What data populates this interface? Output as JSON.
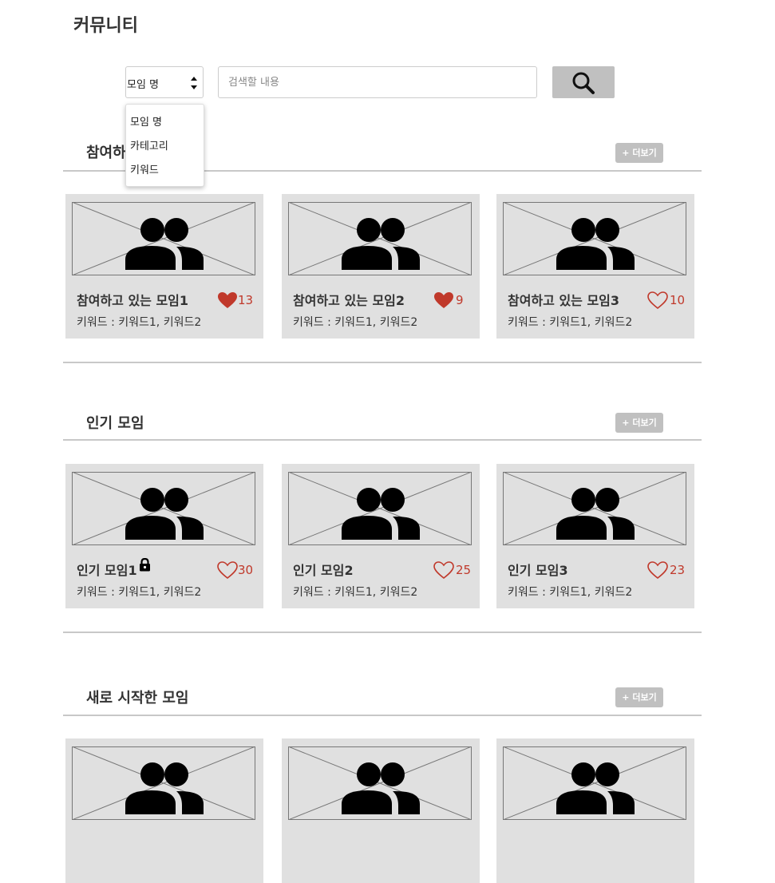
{
  "page_title": "커뮤니티",
  "search": {
    "select_value": "모임 명",
    "placeholder": "검색할 내용",
    "options": [
      "모임 명",
      "카테고리",
      "키워드"
    ]
  },
  "sections": [
    {
      "title": "참여하고 있는 모임",
      "more_label": "+ 더보기",
      "cards": [
        {
          "title": "참여하고 있는 모임1",
          "keywords": "키워드 : 키워드1, 키워드2",
          "likes": "13",
          "liked": true,
          "locked": false
        },
        {
          "title": "참여하고 있는 모임2",
          "keywords": "키워드 : 키워드1, 키워드2",
          "likes": "9",
          "liked": true,
          "locked": false
        },
        {
          "title": "참여하고 있는 모임3",
          "keywords": "키워드 : 키워드1, 키워드2",
          "likes": "10",
          "liked": false,
          "locked": false
        }
      ]
    },
    {
      "title": "인기 모임",
      "more_label": "+ 더보기",
      "cards": [
        {
          "title": "인기 모임1",
          "keywords": "키워드 : 키워드1, 키워드2",
          "likes": "30",
          "liked": false,
          "locked": true
        },
        {
          "title": "인기 모임2",
          "keywords": "키워드 : 키워드1, 키워드2",
          "likes": "25",
          "liked": false,
          "locked": false
        },
        {
          "title": "인기 모임3",
          "keywords": "키워드 : 키워드1, 키워드2",
          "likes": "23",
          "liked": false,
          "locked": false
        }
      ]
    },
    {
      "title": "새로 시작한 모임",
      "more_label": "+ 더보기",
      "cards": [
        {},
        {},
        {}
      ]
    }
  ],
  "colors": {
    "heart": "#c0392b",
    "card_bg": "#e0e0e0",
    "button_bg": "#c0c0c0"
  },
  "icons": {
    "search": "magnifier-icon",
    "group": "group-people-icon",
    "heart": "heart-icon",
    "lock": "lock-icon"
  }
}
